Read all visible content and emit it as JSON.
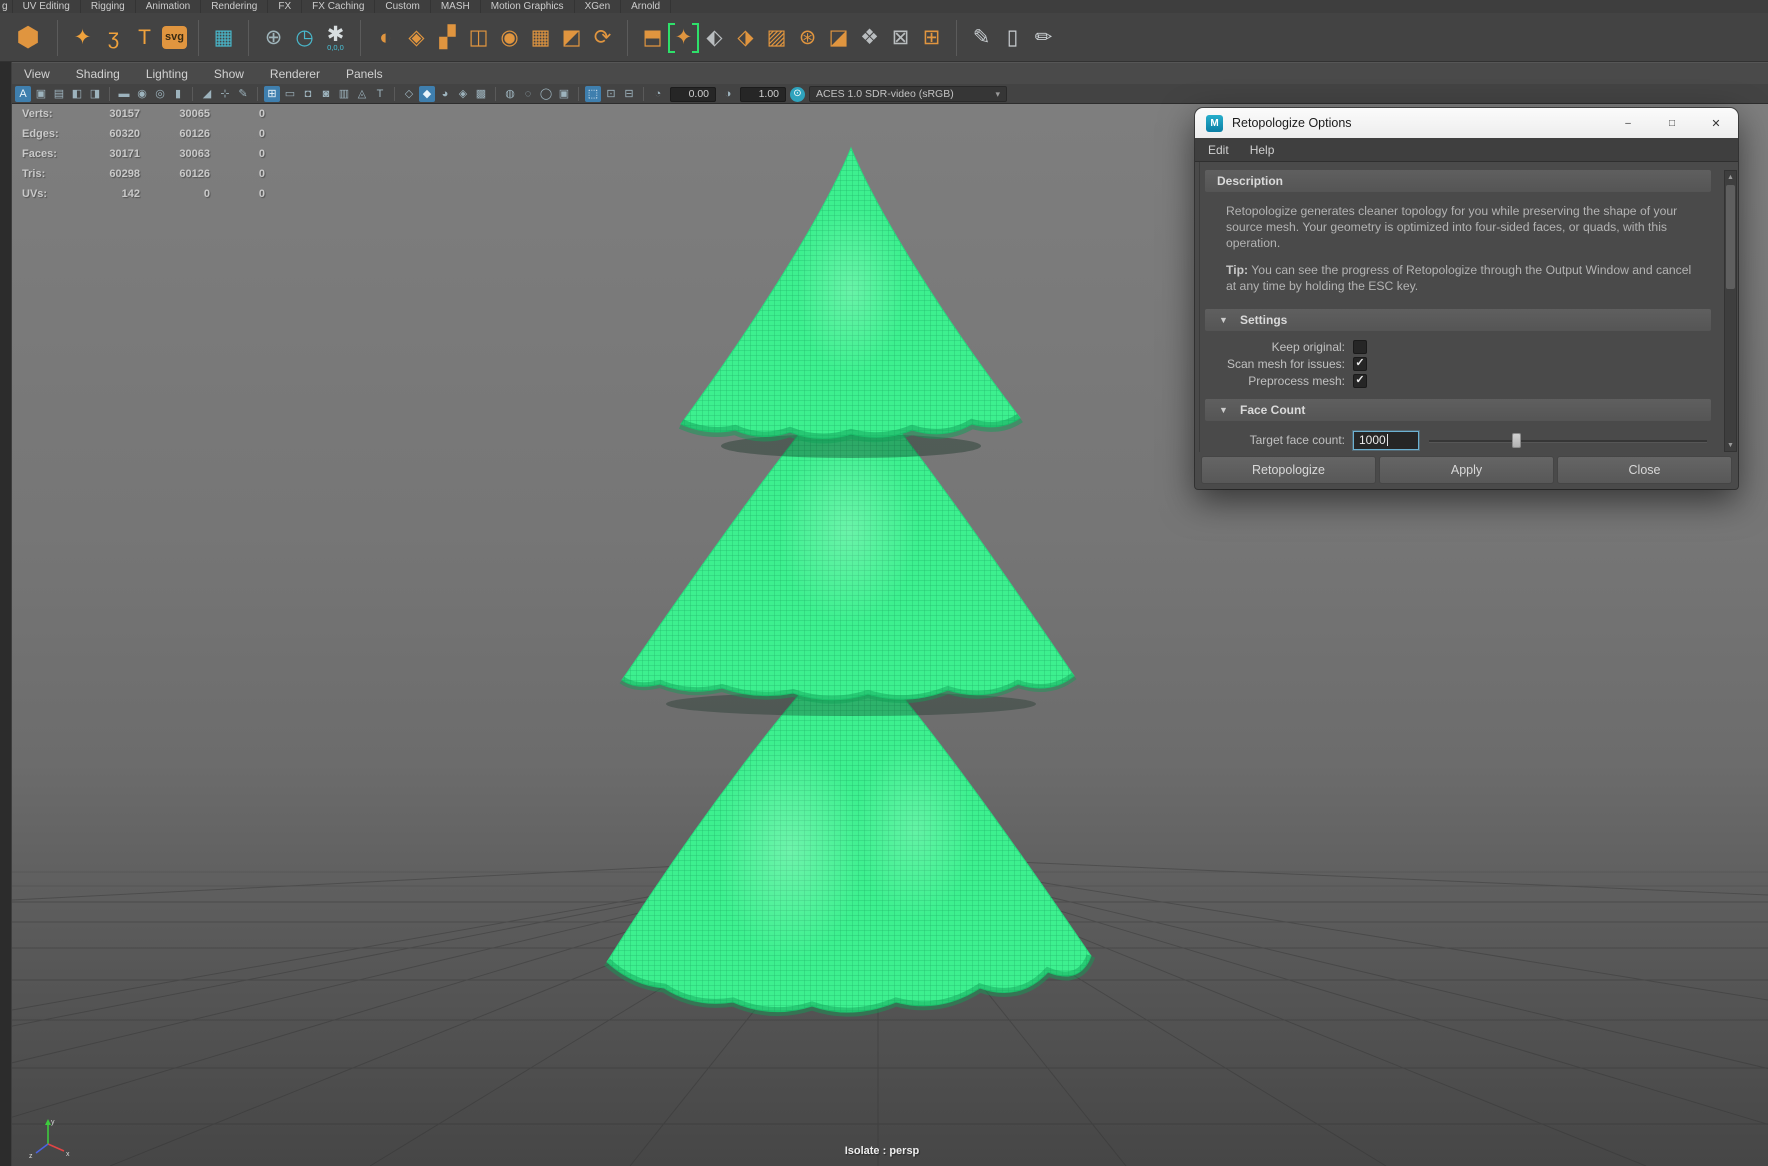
{
  "shelf_tabs": [
    "g",
    "UV Editing",
    "Rigging",
    "Animation",
    "Rendering",
    "FX",
    "FX Caching",
    "Custom",
    "MASH",
    "Motion Graphics",
    "XGen",
    "Arnold"
  ],
  "shelf_icons": [
    {
      "name": "maya-polygon-ball-icon",
      "glyph": "⬢",
      "color": "#e0953f",
      "big": true
    },
    {
      "type": "sep"
    },
    {
      "name": "sparkle-tool-icon",
      "glyph": "✦",
      "color": "#f0a23c"
    },
    {
      "name": "spiral-curve-icon",
      "glyph": "ʒ",
      "color": "#f0a23c"
    },
    {
      "name": "type-tool-icon",
      "glyph": "T",
      "color": "#f0a23c"
    },
    {
      "name": "svg-tool-icon",
      "glyph": "svg",
      "color": "#3a2a12",
      "badge": true
    },
    {
      "type": "sep"
    },
    {
      "name": "node-grid-icon",
      "glyph": "▦",
      "color": "#49b8cc"
    },
    {
      "type": "sep"
    },
    {
      "name": "construction-aim-icon",
      "glyph": "⊕",
      "color": "#9fb4ba"
    },
    {
      "name": "time-options-icon",
      "glyph": "◷",
      "color": "#49b8cc"
    },
    {
      "name": "snap-to-origin-icon",
      "glyph": "✱",
      "color": "#d8dee0",
      "label": "0,0,0"
    },
    {
      "type": "sep"
    },
    {
      "name": "project-sphere-icon",
      "glyph": "◐",
      "color": "#e0953f"
    },
    {
      "name": "diamond-sphere-icon",
      "glyph": "◈",
      "color": "#e0953f"
    },
    {
      "name": "layout-squares-icon",
      "glyph": "▞",
      "color": "#e0953f"
    },
    {
      "name": "mirror-geometry-icon",
      "glyph": "◫",
      "color": "#e0953f"
    },
    {
      "name": "wrap-sphere-icon",
      "glyph": "◉",
      "color": "#e0953f"
    },
    {
      "name": "fill-grid-icon",
      "glyph": "▦",
      "color": "#e0953f"
    },
    {
      "name": "flip-normals-icon",
      "glyph": "◩",
      "color": "#e0953f"
    },
    {
      "name": "rotate-components-icon",
      "glyph": "⟳",
      "color": "#e0953f"
    },
    {
      "type": "sep"
    },
    {
      "name": "extrude-cube-icon",
      "glyph": "⬒",
      "color": "#e0953f"
    },
    {
      "name": "retopologize-tool-icon",
      "glyph": "✦",
      "color": "#e0953f",
      "active": true
    },
    {
      "name": "flow-diamonds-icon",
      "glyph": "⬖",
      "color": "#b9bdbf"
    },
    {
      "name": "cube-corner-icon",
      "glyph": "⬗",
      "color": "#e0953f"
    },
    {
      "name": "reduce-grid-icon",
      "glyph": "▨",
      "color": "#e0953f"
    },
    {
      "name": "wheel-sphere-icon",
      "glyph": "⊛",
      "color": "#e0953f"
    },
    {
      "name": "flip-page-icon",
      "glyph": "◪",
      "color": "#e0953f"
    },
    {
      "name": "spread-diamonds-icon",
      "glyph": "❖",
      "color": "#b9bdbf"
    },
    {
      "name": "boxed-target-icon",
      "glyph": "⊠",
      "color": "#b9bdbf"
    },
    {
      "name": "sphere-grid-icon",
      "glyph": "⊞",
      "color": "#e0953f"
    },
    {
      "type": "sep"
    },
    {
      "name": "curve-pencil-icon",
      "glyph": "✎",
      "color": "#c9ced1"
    },
    {
      "name": "edit-points-icon",
      "glyph": "▯",
      "color": "#c9ced1"
    },
    {
      "name": "quad-pencil-icon",
      "glyph": "✏",
      "color": "#c9ced1"
    }
  ],
  "panel_menu": [
    "View",
    "Shading",
    "Lighting",
    "Show",
    "Renderer",
    "Panels"
  ],
  "viewport_toolbar": {
    "icons": [
      {
        "name": "select-camera-icon",
        "glyph": "A",
        "accent": true
      },
      {
        "name": "lock-camera-icon",
        "glyph": "▣"
      },
      {
        "name": "camera-attributes-icon",
        "glyph": "▤"
      },
      {
        "name": "bookmark-icon",
        "glyph": "◧"
      },
      {
        "name": "image-plane-icon",
        "glyph": "◨"
      },
      {
        "type": "sep"
      },
      {
        "name": "view-video-icon",
        "glyph": "▬"
      },
      {
        "name": "playblast-icon",
        "glyph": "◉"
      },
      {
        "name": "snapshot-icon",
        "glyph": "◎"
      },
      {
        "name": "pane-layout-icon",
        "glyph": "▮"
      },
      {
        "type": "sep"
      },
      {
        "name": "wireframe-icon",
        "glyph": "◢"
      },
      {
        "name": "points-icon",
        "glyph": "⊹"
      },
      {
        "name": "sculpt-pencil-icon",
        "glyph": "✎"
      },
      {
        "type": "sep"
      },
      {
        "name": "grid-toggle-icon",
        "glyph": "⊞",
        "accent": true
      },
      {
        "name": "film-gate-icon",
        "glyph": "▭"
      },
      {
        "name": "resolution-gate-icon",
        "glyph": "◘"
      },
      {
        "name": "gate-mask-icon",
        "glyph": "◙"
      },
      {
        "name": "field-chart-icon",
        "glyph": "▥"
      },
      {
        "name": "safe-action-icon",
        "glyph": "◬"
      },
      {
        "name": "safe-title-icon",
        "glyph": "T"
      },
      {
        "type": "sep"
      },
      {
        "name": "shade-wireframe-icon",
        "glyph": "◇"
      },
      {
        "name": "shade-smooth-icon",
        "glyph": "◆",
        "accent": true
      },
      {
        "name": "shade-textured-icon",
        "glyph": "◕"
      },
      {
        "name": "use-all-lights-icon",
        "glyph": "◈"
      },
      {
        "name": "shadows-icon",
        "glyph": "▩"
      },
      {
        "type": "sep"
      },
      {
        "name": "occlusion-icon",
        "glyph": "◍"
      },
      {
        "name": "motion-blur-icon",
        "glyph": "◌"
      },
      {
        "name": "multisample-icon",
        "glyph": "◯"
      },
      {
        "name": "depth-peeling-icon",
        "glyph": "▣"
      },
      {
        "type": "sep"
      },
      {
        "name": "isolate-select-icon",
        "glyph": "⬚",
        "accent": true
      },
      {
        "name": "xray-icon",
        "glyph": "⊡"
      },
      {
        "name": "joints-xray-icon",
        "glyph": "⊟"
      },
      {
        "type": "sep"
      },
      {
        "name": "exposure-icon",
        "glyph": "◔"
      },
      {
        "type": "field",
        "name": "exposure-field",
        "value": "0.00"
      },
      {
        "name": "gamma-icon",
        "glyph": "◑"
      },
      {
        "type": "field",
        "name": "gamma-field",
        "value": "1.00"
      },
      {
        "name": "color-management-icon",
        "glyph": "⊙",
        "cm": true
      },
      {
        "type": "dropdown",
        "name": "colorspace-dropdown",
        "value": "ACES 1.0 SDR-video (sRGB)"
      }
    ]
  },
  "hud": {
    "rows": [
      {
        "label": "Verts:",
        "current": "30157",
        "selected": "30065",
        "other": "0"
      },
      {
        "label": "Edges:",
        "current": "60320",
        "selected": "60126",
        "other": "0"
      },
      {
        "label": "Faces:",
        "current": "30171",
        "selected": "30063",
        "other": "0"
      },
      {
        "label": "Tris:",
        "current": "60298",
        "selected": "60126",
        "other": "0"
      },
      {
        "label": "UVs:",
        "current": "142",
        "selected": "0",
        "other": "0"
      }
    ]
  },
  "viewport": {
    "isolate_label": "Isolate : persp",
    "axis_labels": {
      "x": "x",
      "y": "y",
      "z": "z"
    }
  },
  "dialog": {
    "title": "Retopologize Options",
    "window_controls": {
      "minimize": "–",
      "maximize": "□",
      "close": "✕"
    },
    "menu": [
      "Edit",
      "Help"
    ],
    "description": {
      "header": "Description",
      "body": "Retopologize generates cleaner topology for you while preserving the shape of your source mesh. Your geometry is optimized into four-sided faces, or quads, with this operation.",
      "tip_label": "Tip:",
      "tip_text": " You can see the progress of Retopologize through the Output Window and cancel at any time by holding the ESC key."
    },
    "settings": {
      "header": "Settings",
      "checkboxes": [
        {
          "label": "Keep original:",
          "checked": false
        },
        {
          "label": "Scan mesh for issues:",
          "checked": true
        },
        {
          "label": "Preprocess mesh:",
          "checked": true
        }
      ]
    },
    "face_count": {
      "header": "Face Count",
      "field_label": "Target face count:",
      "field_value": "1000",
      "slider_pos": 0.31
    },
    "buttons": [
      "Retopologize",
      "Apply",
      "Close"
    ]
  },
  "colors": {
    "mesh_green": "#3df08f",
    "active_bracket": "#2ee06a",
    "focus_blue": "#6cb1d2",
    "shelf_orange": "#e0953f",
    "teal": "#49b8cc"
  }
}
